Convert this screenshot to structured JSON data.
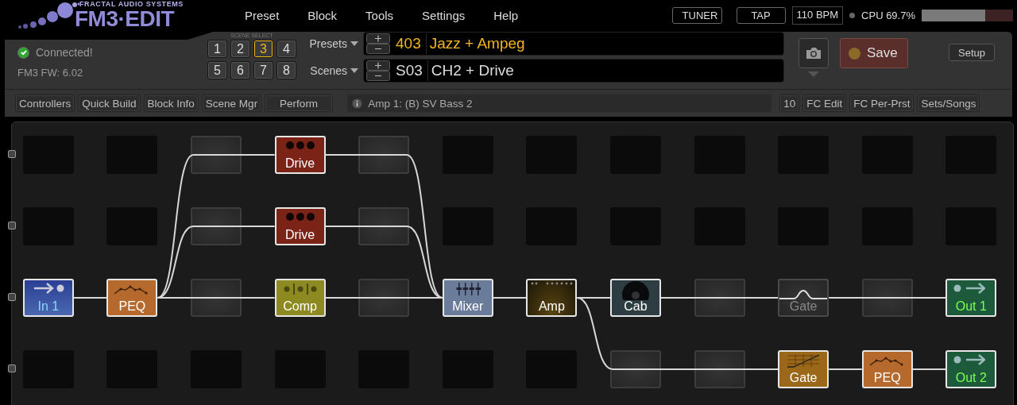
{
  "header": {
    "logo_tagline": "FRACTAL AUDIO SYSTEMS",
    "logo_title": "FM3·EDIT",
    "menu": [
      "Preset",
      "Block",
      "Tools",
      "Settings",
      "Help"
    ],
    "tuner": "TUNER",
    "tap": "TAP",
    "tempo": "110 BPM",
    "cpu": "CPU 69.7%",
    "cpu_meter": {
      "level": 0.697
    }
  },
  "status": {
    "connected": true,
    "connection": "Connected!",
    "firmware": "FM3 FW: 6.02"
  },
  "scene_select": {
    "label": "SCENE SELECT",
    "scenes": [
      {
        "label": "1",
        "selected": false
      },
      {
        "label": "2",
        "selected": false
      },
      {
        "label": "3",
        "selected": true
      },
      {
        "label": "4",
        "selected": false
      },
      {
        "label": "5",
        "selected": false
      },
      {
        "label": "6",
        "selected": false
      },
      {
        "label": "7",
        "selected": false
      },
      {
        "label": "8",
        "selected": false
      }
    ]
  },
  "preset": {
    "label": "Presets",
    "number": "403",
    "name": "Jazz + Ampeg"
  },
  "scene": {
    "label": "Scenes",
    "number": "S03",
    "name": "CH2 + Drive"
  },
  "actions": {
    "save": "Save",
    "setup": "Setup"
  },
  "toolbar": {
    "left": [
      "Controllers",
      "Quick Build",
      "Block Info",
      "Scene Mgr",
      "Perform"
    ],
    "info": "Amp 1: (B) SV Bass 2",
    "count": "10",
    "right": [
      "FC Edit",
      "FC Per-Prst",
      "Sets/Songs"
    ]
  },
  "grid": {
    "rows": [
      [
        {
          "kind": "empty"
        },
        {
          "kind": "empty"
        },
        {
          "kind": "shunt"
        },
        {
          "kind": "drive",
          "label": "Drive",
          "bypassed": false
        },
        {
          "kind": "shunt"
        },
        {
          "kind": "empty"
        },
        {
          "kind": "empty"
        },
        {
          "kind": "empty"
        },
        {
          "kind": "empty"
        },
        {
          "kind": "empty"
        },
        {
          "kind": "empty"
        },
        {
          "kind": "empty"
        }
      ],
      [
        {
          "kind": "empty"
        },
        {
          "kind": "empty"
        },
        {
          "kind": "shunt"
        },
        {
          "kind": "drive",
          "label": "Drive",
          "bypassed": false
        },
        {
          "kind": "shunt"
        },
        {
          "kind": "empty"
        },
        {
          "kind": "empty"
        },
        {
          "kind": "empty"
        },
        {
          "kind": "empty"
        },
        {
          "kind": "empty"
        },
        {
          "kind": "empty"
        },
        {
          "kind": "empty"
        }
      ],
      [
        {
          "kind": "in",
          "label": "In 1",
          "bypassed": false
        },
        {
          "kind": "peq",
          "label": "PEQ",
          "bypassed": false
        },
        {
          "kind": "shunt"
        },
        {
          "kind": "comp",
          "label": "Comp",
          "bypassed": false
        },
        {
          "kind": "shunt"
        },
        {
          "kind": "mixer",
          "label": "Mixer",
          "bypassed": false
        },
        {
          "kind": "amp",
          "label": "Amp",
          "bypassed": false
        },
        {
          "kind": "cab",
          "label": "Cab",
          "bypassed": false
        },
        {
          "kind": "shunt"
        },
        {
          "kind": "gate",
          "label": "Gate",
          "bypassed": true
        },
        {
          "kind": "shunt"
        },
        {
          "kind": "out",
          "label": "Out 1",
          "bypassed": false
        }
      ],
      [
        {
          "kind": "empty"
        },
        {
          "kind": "empty"
        },
        {
          "kind": "empty"
        },
        {
          "kind": "empty"
        },
        {
          "kind": "empty"
        },
        {
          "kind": "empty"
        },
        {
          "kind": "empty"
        },
        {
          "kind": "shunt"
        },
        {
          "kind": "shunt"
        },
        {
          "kind": "gate",
          "label": "Gate",
          "bypassed": false
        },
        {
          "kind": "peq",
          "label": "PEQ",
          "bypassed": false
        },
        {
          "kind": "out",
          "label": "Out 2",
          "bypassed": false
        }
      ]
    ]
  }
}
